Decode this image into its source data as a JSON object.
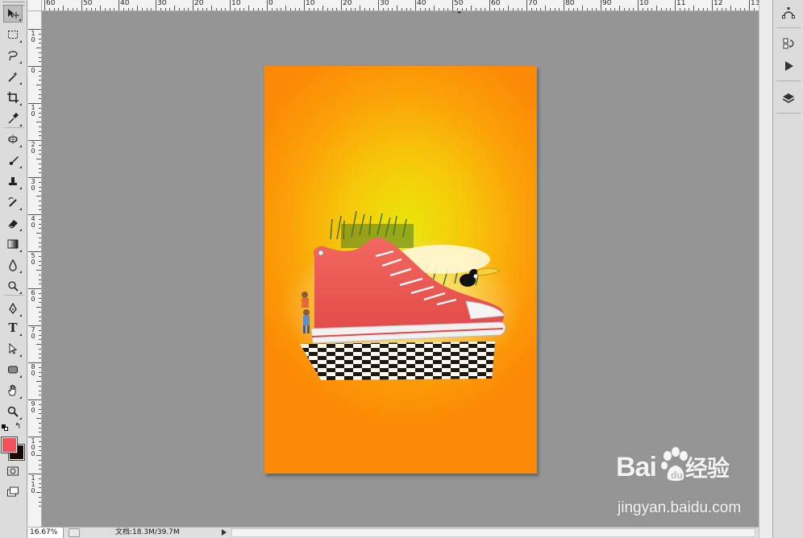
{
  "window": {
    "title": ""
  },
  "rulers": {
    "horizontal_labels": [
      "60",
      "50",
      "40",
      "30",
      "20",
      "10",
      "0",
      "10",
      "20",
      "30",
      "40",
      "50",
      "60",
      "70",
      "80",
      "90",
      "10",
      "11",
      "12",
      "13"
    ],
    "vertical_labels": [
      "1\n0",
      "0",
      "1\n0",
      "2\n0",
      "3\n0",
      "4\n0",
      "5\n0",
      "6\n0",
      "7\n0",
      "8\n0",
      "9\n0",
      "1\n0\n0",
      "1\n1\n0"
    ]
  },
  "tools": [
    {
      "name": "move-tool-icon",
      "active": true
    },
    {
      "name": "marquee-tool-icon"
    },
    {
      "name": "lasso-tool-icon"
    },
    {
      "name": "magic-wand-tool-icon"
    },
    {
      "name": "crop-tool-icon"
    },
    {
      "name": "eyedropper-tool-icon"
    },
    {
      "name": "healing-brush-tool-icon"
    },
    {
      "name": "brush-tool-icon"
    },
    {
      "name": "clone-stamp-tool-icon"
    },
    {
      "name": "history-brush-tool-icon"
    },
    {
      "name": "eraser-tool-icon"
    },
    {
      "name": "gradient-tool-icon"
    },
    {
      "name": "blur-tool-icon"
    },
    {
      "name": "dodge-tool-icon"
    },
    {
      "name": "pen-tool-icon"
    },
    {
      "name": "type-tool-icon"
    },
    {
      "name": "path-selection-tool-icon"
    },
    {
      "name": "shape-tool-icon"
    },
    {
      "name": "hand-tool-icon"
    },
    {
      "name": "zoom-tool-icon"
    }
  ],
  "type_tool_glyph": "T",
  "colors": {
    "foreground": "#f1525a",
    "background": "#1a0a05",
    "canvas_bg": "#959595",
    "doc_center": "#e9e60a",
    "doc_edge": "#fc8a06",
    "shoe": "#ec5a55"
  },
  "status": {
    "zoom": "16.67%",
    "doc_info": "文档:18.3M/39.7M"
  },
  "right_panel": [
    {
      "name": "paths-panel-icon"
    },
    {
      "name": "history-panel-icon"
    },
    {
      "name": "actions-panel-icon"
    },
    {
      "name": "layers-panel-icon"
    }
  ],
  "watermark": {
    "logo": "Bai",
    "logo_suffix": "经验",
    "url": "jingyan.baidu.com"
  }
}
